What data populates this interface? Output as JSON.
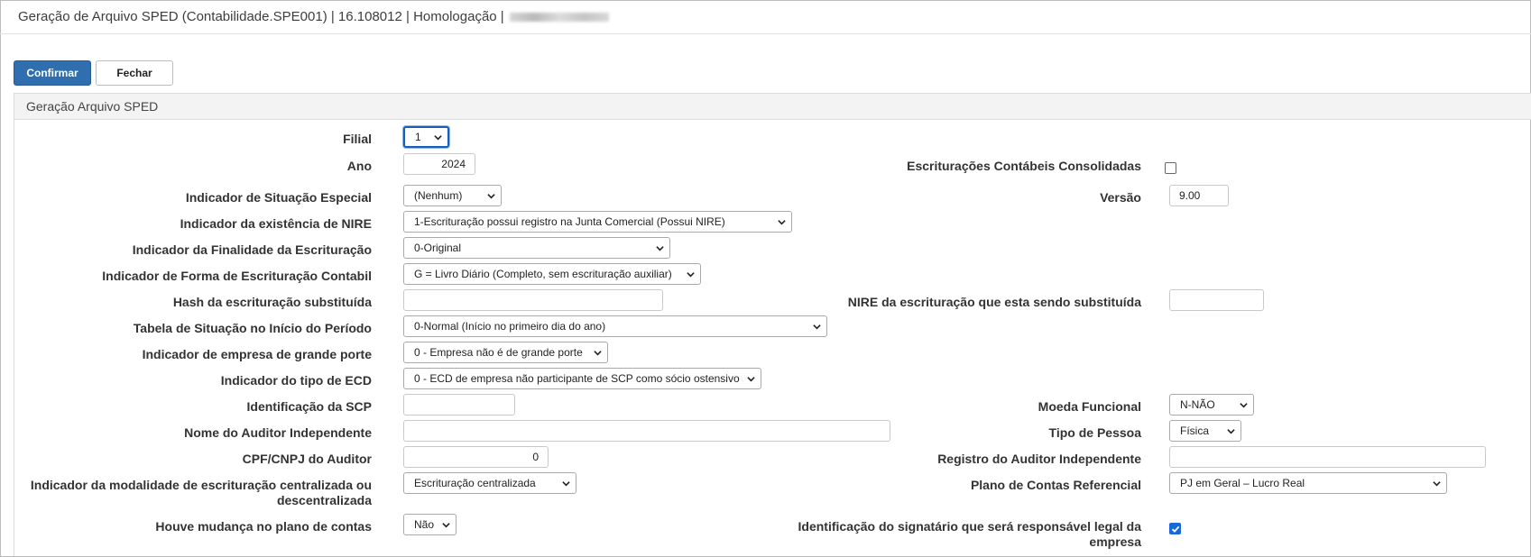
{
  "window": {
    "title": "Geração de Arquivo SPED (Contabilidade.SPE001) | 16.108012 | Homologação |"
  },
  "toolbar": {
    "confirm_label": "Confirmar",
    "close_label": "Fechar"
  },
  "panel": {
    "title": "Geração Arquivo SPED"
  },
  "form": {
    "filial": {
      "label": "Filial",
      "value": "1"
    },
    "ano": {
      "label": "Ano",
      "value": "2024"
    },
    "consolidadas": {
      "label": "Escriturações Contábeis Consolidadas",
      "checked": false
    },
    "situacao_especial": {
      "label": "Indicador de Situação Especial",
      "value": "(Nenhum)"
    },
    "versao": {
      "label": "Versão",
      "value": "9.00"
    },
    "nire": {
      "label": "Indicador da existência de NIRE",
      "value": "1-Escrituração possui registro na Junta Comercial (Possui NIRE)"
    },
    "finalidade": {
      "label": "Indicador da Finalidade da Escrituração",
      "value": "0-Original"
    },
    "forma": {
      "label": "Indicador de Forma de Escrituração Contabil",
      "value": "G = Livro Diário (Completo, sem escrituração auxiliar)"
    },
    "hash": {
      "label": "Hash da escrituração substituída",
      "value": ""
    },
    "nire_substituida": {
      "label": "NIRE da escrituração que esta sendo substituída",
      "value": ""
    },
    "tabela_situacao": {
      "label": "Tabela de Situação no Início do Período",
      "value": "0-Normal (Início no primeiro dia do ano)"
    },
    "grande_porte": {
      "label": "Indicador de empresa de grande porte",
      "value": "0 - Empresa não é de grande porte"
    },
    "tipo_ecd": {
      "label": "Indicador do tipo de ECD",
      "value": "0 - ECD de empresa não participante de SCP como sócio ostensivo"
    },
    "scp": {
      "label": "Identificação da SCP",
      "value": ""
    },
    "moeda": {
      "label": "Moeda Funcional",
      "value": "N-NÃO"
    },
    "auditor_nome": {
      "label": "Nome do Auditor Independente",
      "value": ""
    },
    "tipo_pessoa": {
      "label": "Tipo de Pessoa",
      "value": "Física"
    },
    "auditor_cpf": {
      "label": "CPF/CNPJ do Auditor",
      "value": "0"
    },
    "auditor_registro": {
      "label": "Registro do Auditor Independente",
      "value": ""
    },
    "modalidade": {
      "label_line1": "Indicador da modalidade de escrituração centralizada ou",
      "label_line2": "descentralizada",
      "value": "Escrituração centralizada"
    },
    "plano_referencial": {
      "label": "Plano de Contas Referencial",
      "value": "PJ em Geral – Lucro Real"
    },
    "mudanca_plano": {
      "label": "Houve mudança no plano de contas",
      "value": "Não"
    },
    "signatario": {
      "label_line1": "Identificação do signatário que será responsável legal da",
      "label_line2": "empresa",
      "checked": true
    }
  },
  "icons": {
    "select": "chevron-down-icon",
    "checkbox": "check-icon"
  },
  "colors": {
    "primary_button": "#2f6eaf",
    "checkbox_checked": "#1669d6",
    "focus": "#1a5fb4"
  }
}
